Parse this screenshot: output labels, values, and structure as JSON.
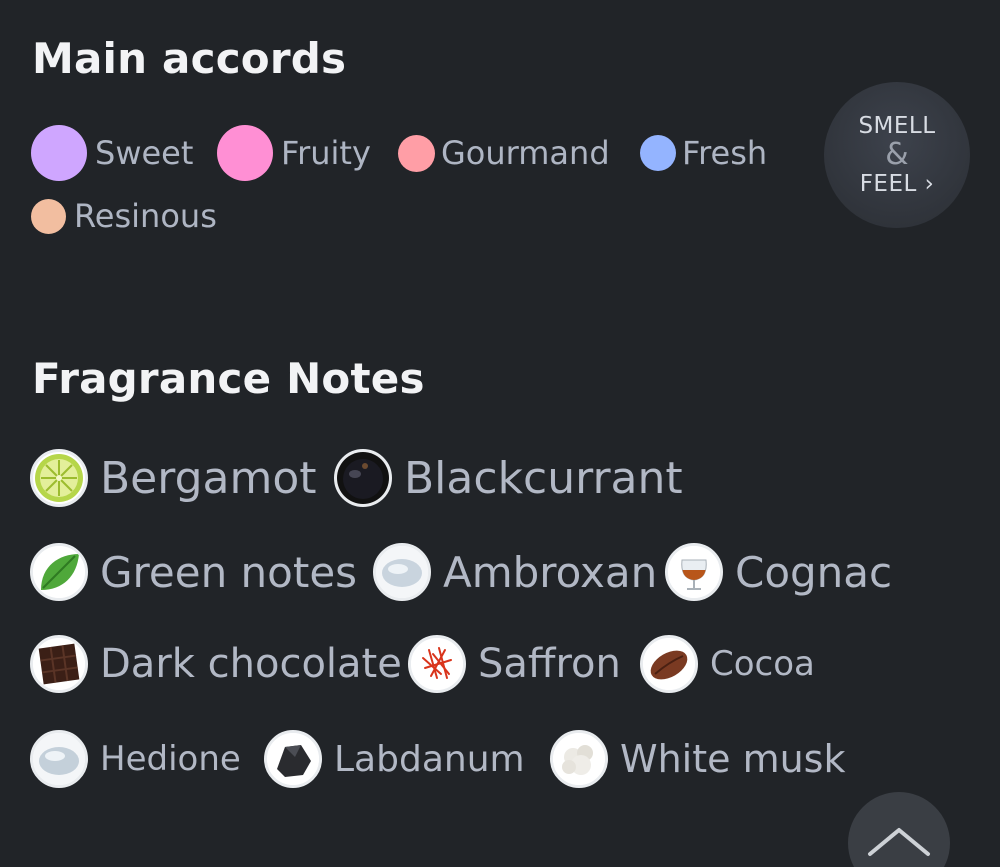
{
  "accords": {
    "title": "Main accords",
    "items": [
      {
        "label": "Sweet",
        "color": "#cfa6ff"
      },
      {
        "label": "Fruity",
        "color": "#ff8fd4"
      },
      {
        "label": "Gourmand",
        "color": "#ff9ea6"
      },
      {
        "label": "Fresh",
        "color": "#94b4ff"
      },
      {
        "label": "Resinous",
        "color": "#f2bea0"
      }
    ]
  },
  "smell_feel": {
    "line1": "SMELL",
    "amp": "&",
    "line2": "FEEL ›"
  },
  "notes": {
    "title": "Fragrance Notes",
    "items": [
      {
        "name": "Bergamot",
        "icon": "bergamot-icon"
      },
      {
        "name": "Blackcurrant",
        "icon": "blackcurrant-icon"
      },
      {
        "name": "Green notes",
        "icon": "green-leaf-icon"
      },
      {
        "name": "Ambroxan",
        "icon": "ambroxan-icon"
      },
      {
        "name": "Cognac",
        "icon": "cognac-glass-icon"
      },
      {
        "name": "Dark chocolate",
        "icon": "dark-chocolate-icon"
      },
      {
        "name": "Saffron",
        "icon": "saffron-icon"
      },
      {
        "name": "Cocoa",
        "icon": "cocoa-bean-icon"
      },
      {
        "name": "Hedione",
        "icon": "hedione-icon"
      },
      {
        "name": "Labdanum",
        "icon": "labdanum-icon"
      },
      {
        "name": "White musk",
        "icon": "white-musk-icon"
      }
    ]
  },
  "scroll_top": {
    "icon": "chevron-up-icon"
  }
}
